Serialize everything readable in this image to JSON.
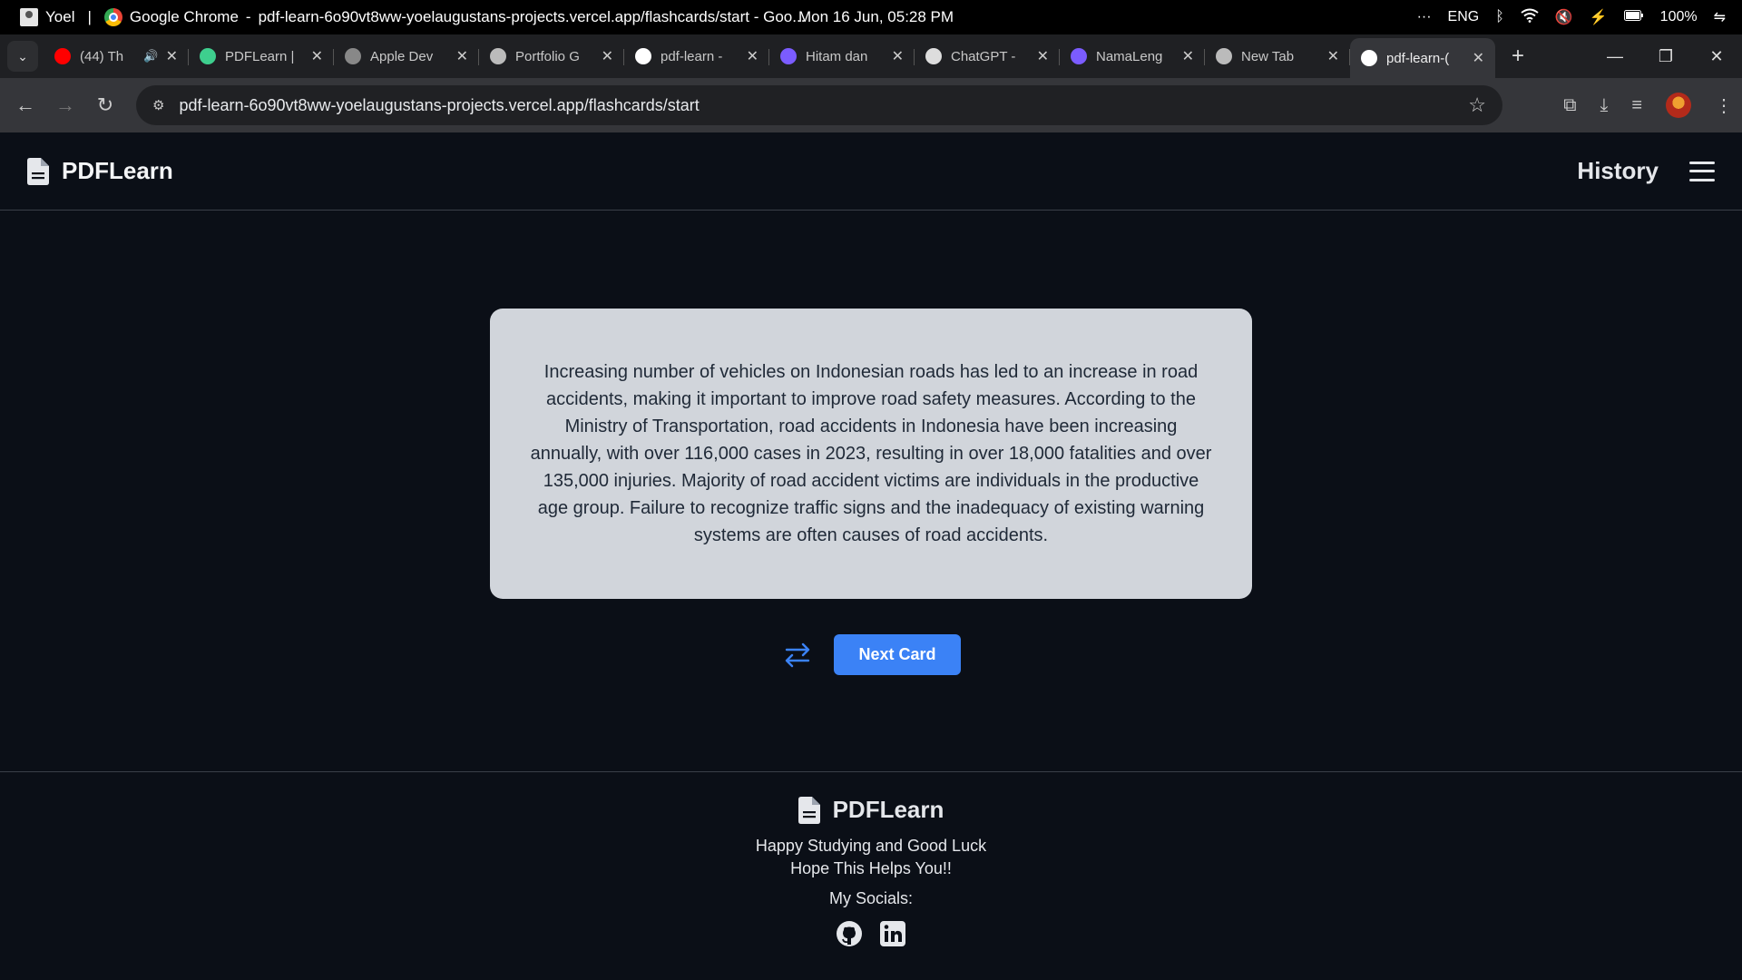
{
  "os": {
    "user": "Yoel",
    "app": "Google Chrome",
    "window_title": "pdf-learn-6o90vt8ww-yoelaugustans-projects.vercel.app/flashcards/start - Goo...",
    "clock": "Mon 16 Jun, 05:28 PM",
    "lang": "ENG",
    "battery": "100%"
  },
  "tabs": [
    {
      "title": "(44) Th",
      "icon": "youtube-icon",
      "color": "#ff0000"
    },
    {
      "title": "PDFLearn |",
      "icon": "bolt-icon",
      "color": "#3ecf8e"
    },
    {
      "title": "Apple Dev",
      "icon": "apple-dev-icon",
      "color": "#888888"
    },
    {
      "title": "Portfolio G",
      "icon": "globe-icon",
      "color": "#bbbbbb"
    },
    {
      "title": "pdf-learn -",
      "icon": "vercel-icon",
      "color": "#ffffff"
    },
    {
      "title": "Hitam dan",
      "icon": "canva-icon",
      "color": "#7b5cff"
    },
    {
      "title": "ChatGPT -",
      "icon": "chatgpt-icon",
      "color": "#dddddd"
    },
    {
      "title": "NamaLeng",
      "icon": "canva-icon",
      "color": "#7b5cff"
    },
    {
      "title": "New Tab",
      "icon": "chrome-icon",
      "color": "#bbbbbb"
    },
    {
      "title": "pdf-learn-(",
      "icon": "vercel-icon",
      "color": "#ffffff"
    }
  ],
  "browser": {
    "url": "pdf-learn-6o90vt8ww-yoelaugustans-projects.vercel.app/flashcards/start"
  },
  "header": {
    "brand": "PDFLearn",
    "history_label": "History"
  },
  "flashcard": {
    "text": "Increasing number of vehicles on Indonesian roads has led to an increase in road accidents, making it important to improve road safety measures. According to the Ministry of Transportation, road accidents in Indonesia have been increasing annually, with over 116,000 cases in 2023, resulting in over 18,000 fatalities and over 135,000 injuries. Majority of road accident victims are individuals in the productive age group. Failure to recognize traffic signs and the inadequacy of existing warning systems are often causes of road accidents."
  },
  "controls": {
    "next_label": "Next Card"
  },
  "footer": {
    "brand": "PDFLearn",
    "line1": "Happy Studying and Good Luck",
    "line2": "Hope This Helps You!!",
    "socials_label": "My Socials:"
  },
  "colors": {
    "background": "#0b0f17",
    "card": "#d1d5db",
    "accent": "#3b82f6"
  }
}
